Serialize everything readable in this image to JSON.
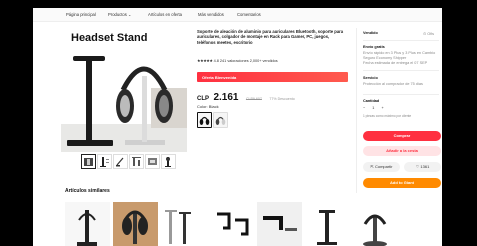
{
  "nav": {
    "items": [
      "Página principal",
      "Productos ⌄",
      "Artículos en oferta",
      "Más vendidos",
      "Comentarios"
    ]
  },
  "gallery": {
    "image_title": "Headset Stand",
    "thumb_count": 6
  },
  "product": {
    "title": "Soporte de aleación de aluminio para auriculares Bluetooth, soporte para auriculares, colgador de montaje en Rack para Gamer, PC, juegos, teléfonos meetes, escritorio",
    "stars": "★★★★★",
    "rating_text": "4.8  241 valoraciones  2,000+ vendidos",
    "promo": "Oferta Bienvenida",
    "currency": "CLP",
    "price": "2.161",
    "old_price": "CLP9.607",
    "discount": "77% Descuento",
    "color_label": "Color: Black",
    "colors": [
      "Black",
      "White"
    ]
  },
  "panel": {
    "sold_by": "Vendido",
    "store_link": "⊙ Ofis",
    "shipping_title": "Envío gratis",
    "shipping_lines": [
      "Envío rápido en 3 Plus y 3 Plus en Cambio",
      "Seguro Economy Shipper",
      "Fecha estimada de entrega el 07 SEP"
    ],
    "service_title": "Servicio",
    "service_line": "Protección al comprador de 75 días",
    "qty_label": "Cantidad",
    "qty_value": "1",
    "stock_text": "1 piezas como máximo por cliente",
    "buy_label": "Comprar",
    "cart_label": "Añadir a la cesta",
    "share_label": "Compartir",
    "fav_label": "1361",
    "gift_label": "Add to Giant"
  },
  "similar": {
    "title": "Artículos similares",
    "count": 7
  },
  "colors": {
    "accent": "#ff3040",
    "orange": "#ff8a00"
  }
}
